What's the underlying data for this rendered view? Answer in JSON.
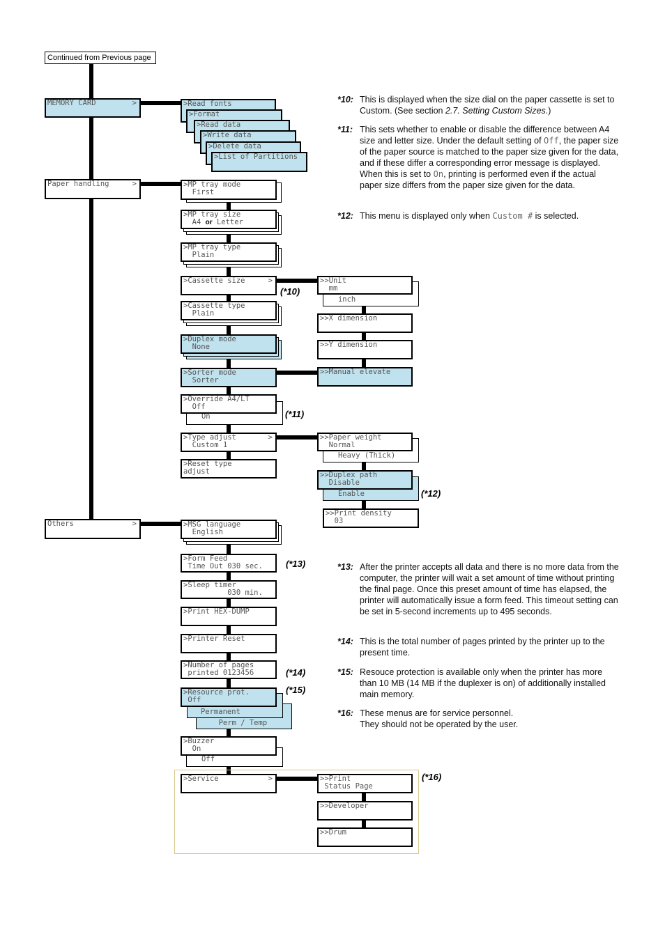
{
  "header": {
    "continued": "Continued from Previous page"
  },
  "colors": {
    "highlight": "#bfe2ee",
    "frame": "#d8c88a"
  },
  "arrow": ">",
  "top_menus": [
    "MEMORY CARD",
    "Paper handling",
    "Others"
  ],
  "memory_card": [
    "Read fonts",
    "Format",
    "Read data",
    "Write data",
    "Delete data",
    "List of Partitions"
  ],
  "paper": {
    "mp_mode": [
      ">MP tray mode",
      "  First"
    ],
    "mp_size": [
      ">MP tray size",
      "  A4",
      "or",
      "Letter"
    ],
    "mp_type": [
      ">MP tray type",
      "  Plain"
    ],
    "cass_size": [
      ">Cassette size"
    ],
    "cass_type": [
      ">Cassette type",
      "  Plain"
    ],
    "duplex": [
      ">Duplex mode",
      "  None"
    ],
    "sorter": [
      ">Sorter mode",
      "  Sorter"
    ],
    "override": [
      ">Override A4/LT",
      "  Off",
      "   On"
    ],
    "type_adj": [
      ">Type adjust",
      "  Custom 1"
    ],
    "reset": [
      ">Reset type",
      "adjust"
    ]
  },
  "sub": {
    "unit": [
      ">>Unit",
      "  mm",
      "   inch"
    ],
    "xdim": [
      ">>X dimension"
    ],
    "ydim": [
      ">>Y dimension"
    ],
    "manual": [
      ">>Manual elevate"
    ],
    "weight": [
      ">>Paper weight",
      "  Normal",
      "   Heavy (Thick)"
    ],
    "dpath": [
      ">>Duplex path",
      "  Disable",
      "   Enable"
    ],
    "density": [
      ">>Print density",
      "  03"
    ],
    "status": [
      ">>Print",
      " Status Page"
    ],
    "developer": [
      ">>Developer"
    ],
    "drum": [
      ">>Drum"
    ]
  },
  "others": {
    "msg": [
      ">MSG language",
      "  English"
    ],
    "form": [
      ">Form Feed",
      " Time Out 030 sec."
    ],
    "sleep": [
      ">Sleep timer",
      "          030 min."
    ],
    "hex": [
      ">Print HEX-DUMP"
    ],
    "preset": [
      ">Printer Reset"
    ],
    "pages": [
      ">Number of pages",
      " printed 0123456"
    ],
    "res": [
      ">Resource prot.",
      " Off",
      "   Permanent",
      "     Perm / Temp"
    ],
    "buzzer": [
      ">Buzzer",
      "  On",
      "   Off"
    ],
    "service": [
      ">Service"
    ]
  },
  "labels": {
    "l10": "(*10)",
    "l11": "(*11)",
    "l12": "(*12)",
    "l13": "(*13)",
    "l14": "(*14)",
    "l15": "(*15)",
    "l16": "(*16)"
  },
  "notes": {
    "n10": {
      "key": "*10:",
      "a": "This is displayed when the size dial on the paper cassette is set to Custom. (See section ",
      "em": "2.7. Setting Custom Sizes",
      "b": ".)"
    },
    "n11": {
      "key": "*11:",
      "a": "This sets whether to enable or disable the difference between A4 size and letter size. Under the default setting of ",
      "m1": "Off",
      "b": ", the paper size of the paper source is matched to the paper size given for the data, and if these differ a corresponding error message is displayed. When this is set to ",
      "m2": "On",
      "c": ", printing is performed even if the actual paper size differs from the paper size given for the data."
    },
    "n12": {
      "key": "*12:",
      "a": "This menu is displayed only when ",
      "m1": "Custom #",
      "b": " is selected."
    },
    "n13": {
      "key": "*13:",
      "a": "After the printer accepts all data and there is no more data from the computer, the printer will wait a set amount of time without printing the final page. Once this preset amount of time has elapsed, the printer will automatically issue a form feed. This timeout setting can be set in 5-second increments up to 495 seconds."
    },
    "n14": {
      "key": "*14:",
      "a": "This is the total number of pages printed by the printer up to the present time."
    },
    "n15": {
      "key": "*15:",
      "a": "Resouce protection is available only when the printer has more than 10 MB (14 MB if the duplexer is on) of additionally installed main memory."
    },
    "n16": {
      "key": "*16:",
      "a": "These menus are for service personnel.",
      "b": "They should not be operated by the user."
    }
  }
}
